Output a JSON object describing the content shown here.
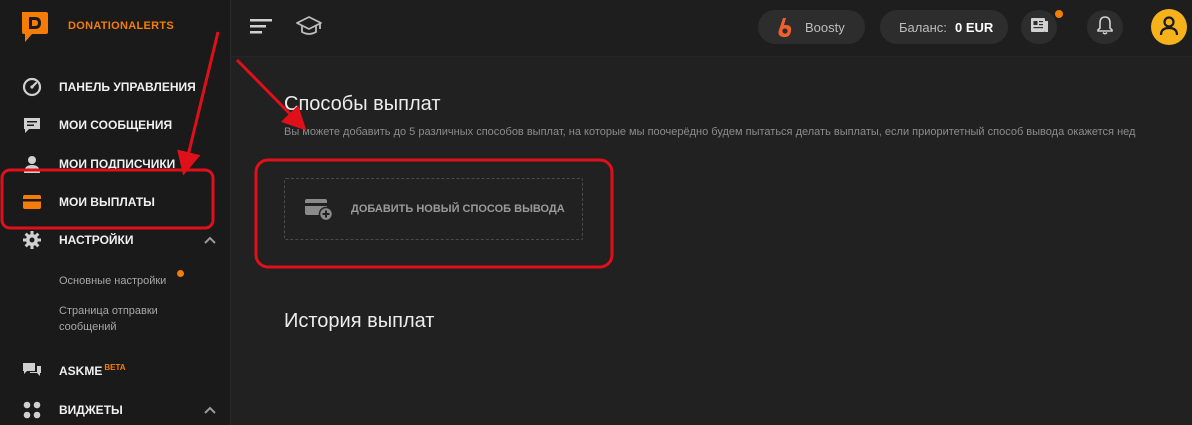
{
  "brand": {
    "name": "DONATIONALERTS",
    "accent": "#f57d07"
  },
  "header": {
    "boosty_label": "Boosty",
    "balance_label": "Баланс:",
    "balance_value": "0 EUR"
  },
  "sidebar": {
    "items": [
      {
        "label": "ПАНЕЛЬ УПРАВЛЕНИЯ",
        "icon": "dashboard-icon"
      },
      {
        "label": "МОИ СООБЩЕНИЯ",
        "icon": "messages-icon"
      },
      {
        "label": "МОИ ПОДПИСЧИКИ",
        "icon": "subscribers-icon"
      },
      {
        "label": "МОИ ВЫПЛАТЫ",
        "icon": "card-icon",
        "active": true
      },
      {
        "label": "НАСТРОЙКИ",
        "icon": "gear-icon",
        "expanded": true
      },
      {
        "label": "ASKME",
        "badge": "BETA",
        "icon": "chat-icon"
      },
      {
        "label": "ВИДЖЕТЫ",
        "icon": "widgets-icon",
        "expanded": true
      }
    ],
    "settings_sub": {
      "main": "Основные настройки",
      "page_line1": "Страница отправки",
      "page_line2": "сообщений"
    }
  },
  "main": {
    "payout_methods_title": "Способы выплат",
    "payout_methods_desc": "Вы можете добавить до 5 различных способов выплат, на которые мы поочерёдно будем пытаться делать выплаты, если приоритетный способ вывода окажется нед",
    "add_method_label": "ДОБАВИТЬ НОВЫЙ СПОСОБ ВЫВОДА",
    "history_title": "История выплат"
  },
  "colors": {
    "sidebar_bg": "#1a1a1a",
    "main_bg": "#212121",
    "annotation_red": "#e0101a",
    "notification_dot": "#f57d07"
  }
}
